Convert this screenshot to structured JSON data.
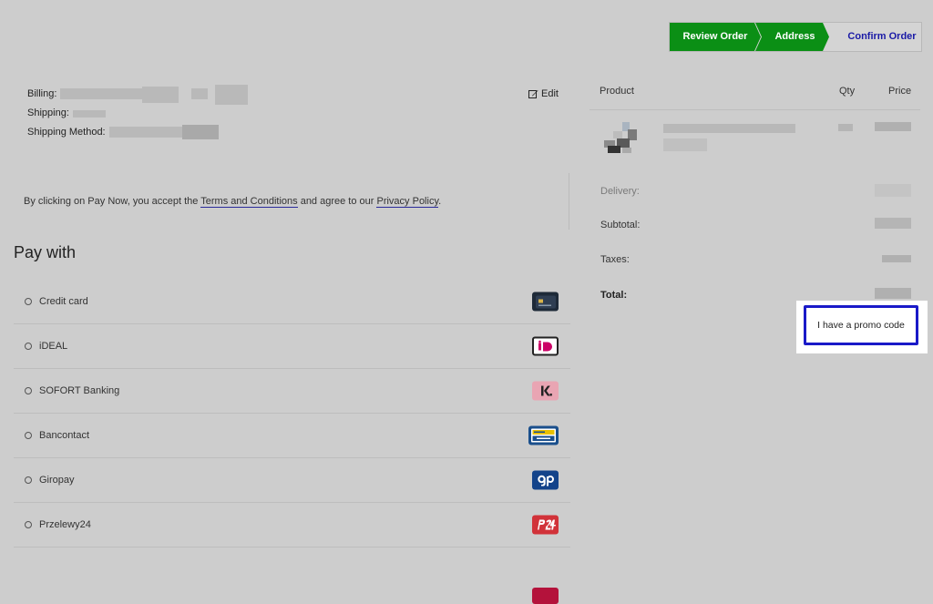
{
  "stepper": {
    "steps": [
      "Review Order",
      "Address",
      "Confirm Order"
    ]
  },
  "summary": {
    "billing_label": "Billing:",
    "shipping_label": "Shipping:",
    "shipping_method_label": "Shipping Method:",
    "edit_label": "Edit"
  },
  "terms": {
    "prefix": "By clicking on Pay Now, you accept the ",
    "terms_link": "Terms and Conditions",
    "middle": " and agree to our ",
    "privacy_link": "Privacy Policy",
    "suffix": "."
  },
  "pay_with": {
    "title": "Pay with",
    "methods": [
      {
        "label": "Credit card",
        "icon": "credit-card-icon"
      },
      {
        "label": "iDEAL",
        "icon": "ideal-icon"
      },
      {
        "label": "SOFORT Banking",
        "icon": "sofort-icon"
      },
      {
        "label": "Bancontact",
        "icon": "bancontact-icon"
      },
      {
        "label": "Giropay",
        "icon": "giropay-icon"
      },
      {
        "label": "Przelewy24",
        "icon": "przelewy24-icon"
      }
    ]
  },
  "order": {
    "headers": {
      "product": "Product",
      "qty": "Qty",
      "price": "Price"
    },
    "delivery_label": "Delivery:",
    "subtotal_label": "Subtotal:",
    "taxes_label": "Taxes:",
    "total_label": "Total:"
  },
  "promo": {
    "label": "I have a promo code"
  },
  "colors": {
    "accent": "#0b8f15",
    "link": "#1a1aa6",
    "promo_border": "#1a1ac8"
  }
}
